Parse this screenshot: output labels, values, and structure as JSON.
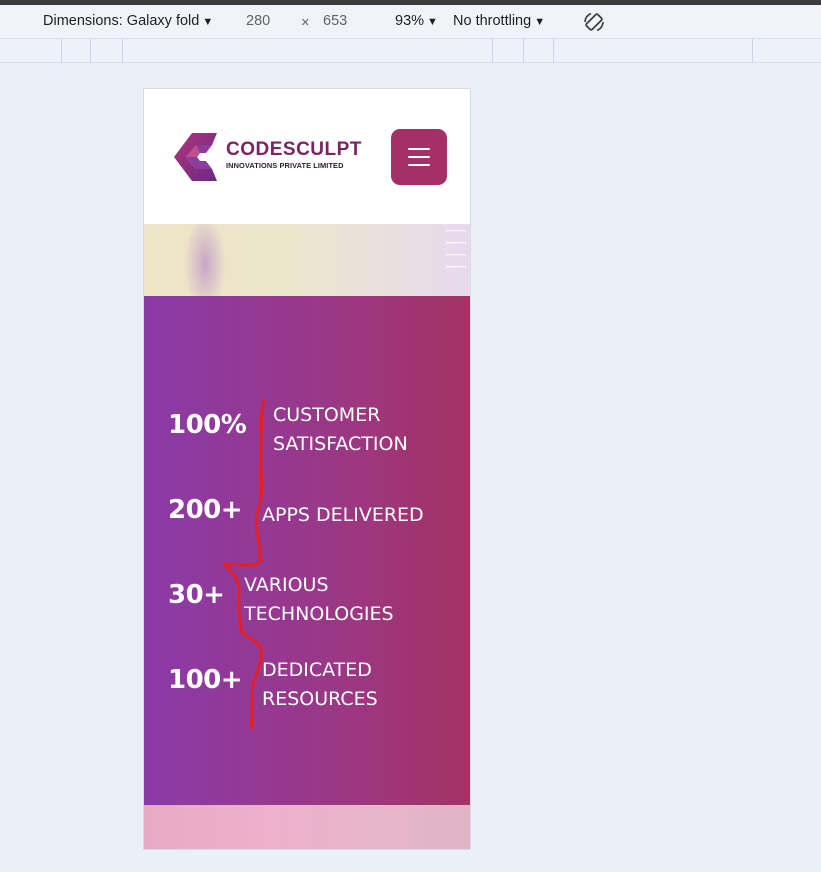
{
  "devtools": {
    "dimensions_label": "Dimensions: Galaxy fold",
    "width": "280",
    "times": "×",
    "height": "653",
    "zoom": "93%",
    "throttling": "No throttling"
  },
  "header": {
    "logo_name": "CODESCULPT",
    "logo_sub": "INNOVATIONS PRIVATE LIMITED",
    "brand_color": "#a33167",
    "menu_icon": "hamburger-menu-icon"
  },
  "stats": [
    {
      "number": "100%",
      "label_lines": [
        "CUSTOMER",
        "SATISFACTION"
      ]
    },
    {
      "number": "200+",
      "label_lines": [
        "APPS DELIVERED"
      ]
    },
    {
      "number": "30+",
      "label_lines": [
        "VARIOUS",
        "TECHNOLOGIES"
      ]
    },
    {
      "number": "100+",
      "label_lines": [
        "DEDICATED",
        "RESOURCES"
      ]
    }
  ],
  "colors": {
    "stats_gradient_start": "#8a3aa8",
    "stats_gradient_end": "#a43263",
    "annotation_line": "#e0202a"
  }
}
